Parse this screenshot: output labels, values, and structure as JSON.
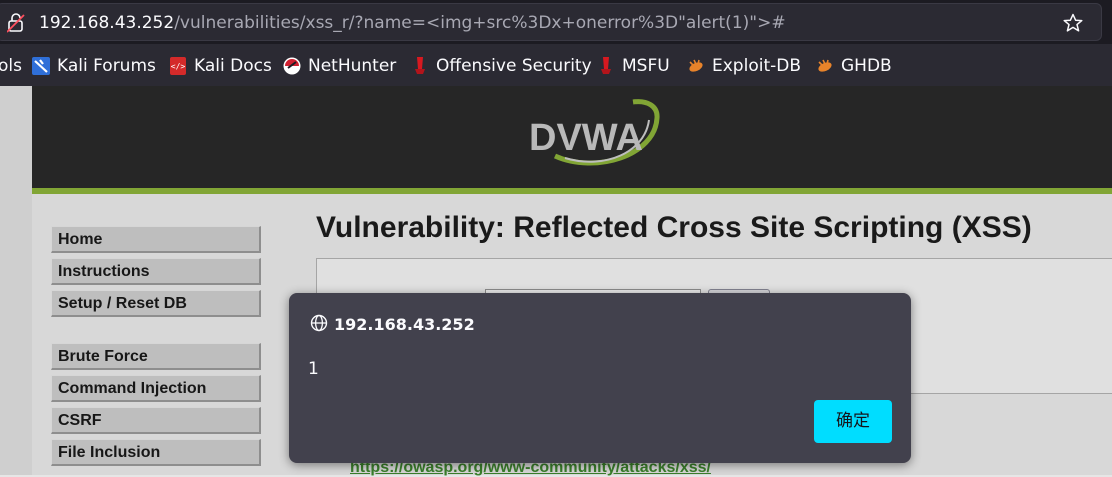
{
  "browser": {
    "url_host": "192.168.43.252",
    "url_path": "/vulnerabilities/xss_r/?name=<img+src%3Dx+onerror%3D\"alert(1)\">#"
  },
  "bookmarks": [
    {
      "label": "ols",
      "icon": "kali-tools-icon"
    },
    {
      "label": "Kali Forums",
      "icon": "kali-forums-icon"
    },
    {
      "label": "Kali Docs",
      "icon": "kali-docs-icon"
    },
    {
      "label": "NetHunter",
      "icon": "nethunter-icon"
    },
    {
      "label": "Offensive Security",
      "icon": "offsec-icon"
    },
    {
      "label": "MSFU",
      "icon": "msfu-icon"
    },
    {
      "label": "Exploit-DB",
      "icon": "exploit-db-icon"
    },
    {
      "label": "GHDB",
      "icon": "ghdb-icon"
    }
  ],
  "dvwa": {
    "logo": "DVWA",
    "title": "Vulnerability: Reflected Cross Site Scripting (XSS)",
    "menu": [
      "Home",
      "Instructions",
      "Setup / Reset DB",
      "Brute Force",
      "Command Injection",
      "CSRF",
      "File Inclusion"
    ],
    "more_info_link": "https://owasp.org/www-community/attacks/xss/"
  },
  "dialog": {
    "origin": "192.168.43.252",
    "message": "1",
    "ok_label": "确定"
  },
  "colors": {
    "dialog_bg": "#42414d",
    "ok_button": "#00ddff",
    "dvwa_green": "#8db33a",
    "dvwa_header": "#2a2a2a"
  }
}
